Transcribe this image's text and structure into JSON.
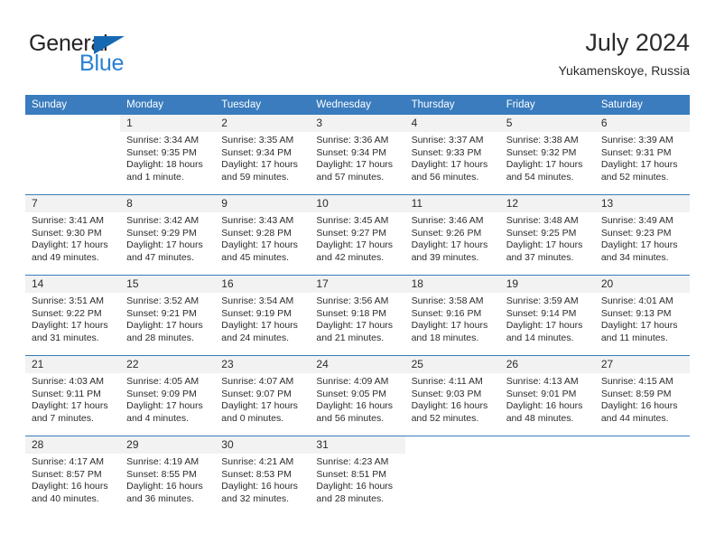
{
  "brand": {
    "name_part1": "General",
    "name_part2": "Blue",
    "triangle_color": "#1668b3",
    "blue_color": "#2a7fd4"
  },
  "header": {
    "title": "July 2024",
    "subtitle": "Yukamenskoye, Russia",
    "accent_color": "#3a7cbe"
  },
  "weekday_headers": [
    "Sunday",
    "Monday",
    "Tuesday",
    "Wednesday",
    "Thursday",
    "Friday",
    "Saturday"
  ],
  "weeks": [
    [
      {
        "day": "",
        "lines": []
      },
      {
        "day": "1",
        "lines": [
          "Sunrise: 3:34 AM",
          "Sunset: 9:35 PM",
          "Daylight: 18 hours",
          "and 1 minute."
        ]
      },
      {
        "day": "2",
        "lines": [
          "Sunrise: 3:35 AM",
          "Sunset: 9:34 PM",
          "Daylight: 17 hours",
          "and 59 minutes."
        ]
      },
      {
        "day": "3",
        "lines": [
          "Sunrise: 3:36 AM",
          "Sunset: 9:34 PM",
          "Daylight: 17 hours",
          "and 57 minutes."
        ]
      },
      {
        "day": "4",
        "lines": [
          "Sunrise: 3:37 AM",
          "Sunset: 9:33 PM",
          "Daylight: 17 hours",
          "and 56 minutes."
        ]
      },
      {
        "day": "5",
        "lines": [
          "Sunrise: 3:38 AM",
          "Sunset: 9:32 PM",
          "Daylight: 17 hours",
          "and 54 minutes."
        ]
      },
      {
        "day": "6",
        "lines": [
          "Sunrise: 3:39 AM",
          "Sunset: 9:31 PM",
          "Daylight: 17 hours",
          "and 52 minutes."
        ]
      }
    ],
    [
      {
        "day": "7",
        "lines": [
          "Sunrise: 3:41 AM",
          "Sunset: 9:30 PM",
          "Daylight: 17 hours",
          "and 49 minutes."
        ]
      },
      {
        "day": "8",
        "lines": [
          "Sunrise: 3:42 AM",
          "Sunset: 9:29 PM",
          "Daylight: 17 hours",
          "and 47 minutes."
        ]
      },
      {
        "day": "9",
        "lines": [
          "Sunrise: 3:43 AM",
          "Sunset: 9:28 PM",
          "Daylight: 17 hours",
          "and 45 minutes."
        ]
      },
      {
        "day": "10",
        "lines": [
          "Sunrise: 3:45 AM",
          "Sunset: 9:27 PM",
          "Daylight: 17 hours",
          "and 42 minutes."
        ]
      },
      {
        "day": "11",
        "lines": [
          "Sunrise: 3:46 AM",
          "Sunset: 9:26 PM",
          "Daylight: 17 hours",
          "and 39 minutes."
        ]
      },
      {
        "day": "12",
        "lines": [
          "Sunrise: 3:48 AM",
          "Sunset: 9:25 PM",
          "Daylight: 17 hours",
          "and 37 minutes."
        ]
      },
      {
        "day": "13",
        "lines": [
          "Sunrise: 3:49 AM",
          "Sunset: 9:23 PM",
          "Daylight: 17 hours",
          "and 34 minutes."
        ]
      }
    ],
    [
      {
        "day": "14",
        "lines": [
          "Sunrise: 3:51 AM",
          "Sunset: 9:22 PM",
          "Daylight: 17 hours",
          "and 31 minutes."
        ]
      },
      {
        "day": "15",
        "lines": [
          "Sunrise: 3:52 AM",
          "Sunset: 9:21 PM",
          "Daylight: 17 hours",
          "and 28 minutes."
        ]
      },
      {
        "day": "16",
        "lines": [
          "Sunrise: 3:54 AM",
          "Sunset: 9:19 PM",
          "Daylight: 17 hours",
          "and 24 minutes."
        ]
      },
      {
        "day": "17",
        "lines": [
          "Sunrise: 3:56 AM",
          "Sunset: 9:18 PM",
          "Daylight: 17 hours",
          "and 21 minutes."
        ]
      },
      {
        "day": "18",
        "lines": [
          "Sunrise: 3:58 AM",
          "Sunset: 9:16 PM",
          "Daylight: 17 hours",
          "and 18 minutes."
        ]
      },
      {
        "day": "19",
        "lines": [
          "Sunrise: 3:59 AM",
          "Sunset: 9:14 PM",
          "Daylight: 17 hours",
          "and 14 minutes."
        ]
      },
      {
        "day": "20",
        "lines": [
          "Sunrise: 4:01 AM",
          "Sunset: 9:13 PM",
          "Daylight: 17 hours",
          "and 11 minutes."
        ]
      }
    ],
    [
      {
        "day": "21",
        "lines": [
          "Sunrise: 4:03 AM",
          "Sunset: 9:11 PM",
          "Daylight: 17 hours",
          "and 7 minutes."
        ]
      },
      {
        "day": "22",
        "lines": [
          "Sunrise: 4:05 AM",
          "Sunset: 9:09 PM",
          "Daylight: 17 hours",
          "and 4 minutes."
        ]
      },
      {
        "day": "23",
        "lines": [
          "Sunrise: 4:07 AM",
          "Sunset: 9:07 PM",
          "Daylight: 17 hours",
          "and 0 minutes."
        ]
      },
      {
        "day": "24",
        "lines": [
          "Sunrise: 4:09 AM",
          "Sunset: 9:05 PM",
          "Daylight: 16 hours",
          "and 56 minutes."
        ]
      },
      {
        "day": "25",
        "lines": [
          "Sunrise: 4:11 AM",
          "Sunset: 9:03 PM",
          "Daylight: 16 hours",
          "and 52 minutes."
        ]
      },
      {
        "day": "26",
        "lines": [
          "Sunrise: 4:13 AM",
          "Sunset: 9:01 PM",
          "Daylight: 16 hours",
          "and 48 minutes."
        ]
      },
      {
        "day": "27",
        "lines": [
          "Sunrise: 4:15 AM",
          "Sunset: 8:59 PM",
          "Daylight: 16 hours",
          "and 44 minutes."
        ]
      }
    ],
    [
      {
        "day": "28",
        "lines": [
          "Sunrise: 4:17 AM",
          "Sunset: 8:57 PM",
          "Daylight: 16 hours",
          "and 40 minutes."
        ]
      },
      {
        "day": "29",
        "lines": [
          "Sunrise: 4:19 AM",
          "Sunset: 8:55 PM",
          "Daylight: 16 hours",
          "and 36 minutes."
        ]
      },
      {
        "day": "30",
        "lines": [
          "Sunrise: 4:21 AM",
          "Sunset: 8:53 PM",
          "Daylight: 16 hours",
          "and 32 minutes."
        ]
      },
      {
        "day": "31",
        "lines": [
          "Sunrise: 4:23 AM",
          "Sunset: 8:51 PM",
          "Daylight: 16 hours",
          "and 28 minutes."
        ]
      },
      {
        "day": "",
        "lines": []
      },
      {
        "day": "",
        "lines": []
      },
      {
        "day": "",
        "lines": []
      }
    ]
  ]
}
